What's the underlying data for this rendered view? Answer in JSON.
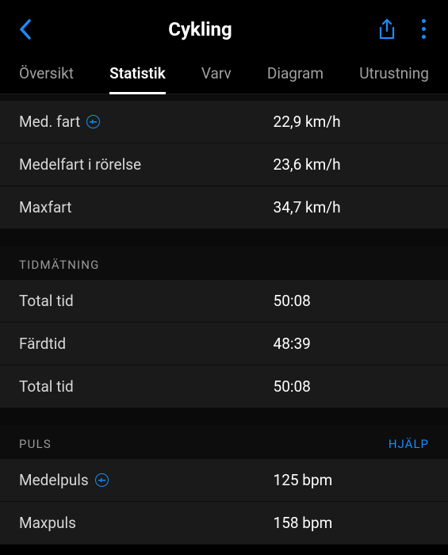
{
  "header": {
    "title": "Cykling"
  },
  "tabs": [
    {
      "label": "Översikt"
    },
    {
      "label": "Statistik"
    },
    {
      "label": "Varv"
    },
    {
      "label": "Diagram"
    },
    {
      "label": "Utrustning"
    }
  ],
  "activeTabIndex": 1,
  "speed": {
    "rows": [
      {
        "label": "Med. fart",
        "value": "22,9 km/h",
        "icon": true
      },
      {
        "label": "Medelfart i rörelse",
        "value": "23,6 km/h",
        "icon": false
      },
      {
        "label": "Maxfart",
        "value": "34,7 km/h",
        "icon": false
      }
    ]
  },
  "timing": {
    "title": "TIDMÄTNING",
    "rows": [
      {
        "label": "Total tid",
        "value": "50:08"
      },
      {
        "label": "Färdtid",
        "value": "48:39"
      },
      {
        "label": "Total tid",
        "value": "50:08"
      }
    ]
  },
  "pulse": {
    "title": "PULS",
    "help": "HJÄLP",
    "rows": [
      {
        "label": "Medelpuls",
        "value": "125 bpm",
        "icon": true
      },
      {
        "label": "Maxpuls",
        "value": "158 bpm",
        "icon": false
      }
    ]
  }
}
